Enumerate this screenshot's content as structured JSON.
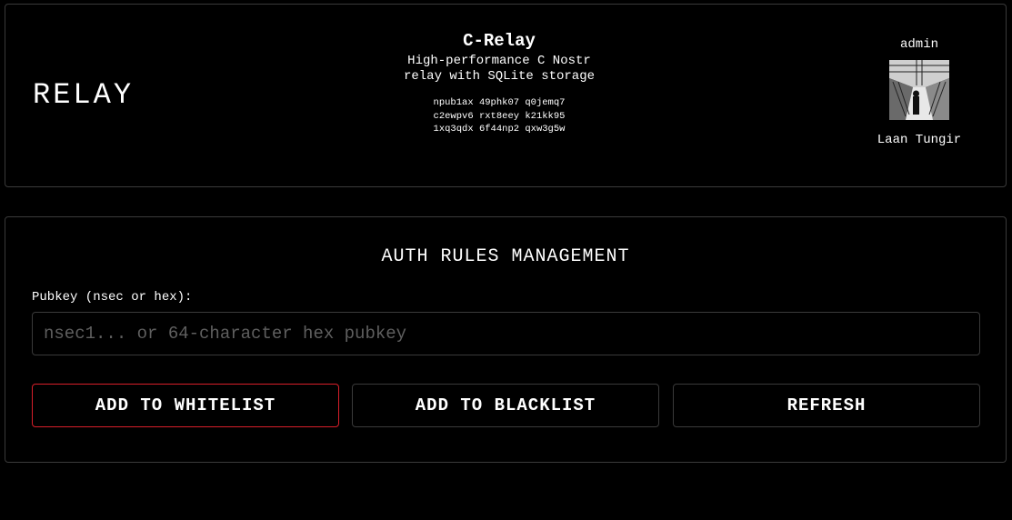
{
  "header": {
    "logo": "RELAY",
    "relay": {
      "name": "C-Relay",
      "description": "High-performance C Nostr relay with SQLite storage",
      "pubkey_lines": [
        "npub1ax 49phk07 q0jemq7",
        "c2ewpv6 rxt8eey k21kk95",
        "1xq3qdx 6f44np2 qxw3g5w"
      ]
    },
    "admin": {
      "label": "admin",
      "name": "Laan Tungir",
      "avatar_icon": "user-avatar-photo"
    }
  },
  "auth_rules": {
    "title": "AUTH RULES MANAGEMENT",
    "pubkey_label": "Pubkey (nsec or hex):",
    "pubkey_value": "",
    "pubkey_placeholder": "nsec1... or 64-character hex pubkey",
    "buttons": {
      "whitelist": "ADD TO WHITELIST",
      "blacklist": "ADD TO BLACKLIST",
      "refresh": "REFRESH"
    }
  },
  "colors": {
    "background": "#000000",
    "border": "#3a3a3a",
    "accent_red": "#d81f2a",
    "placeholder": "#5f5f5f"
  }
}
